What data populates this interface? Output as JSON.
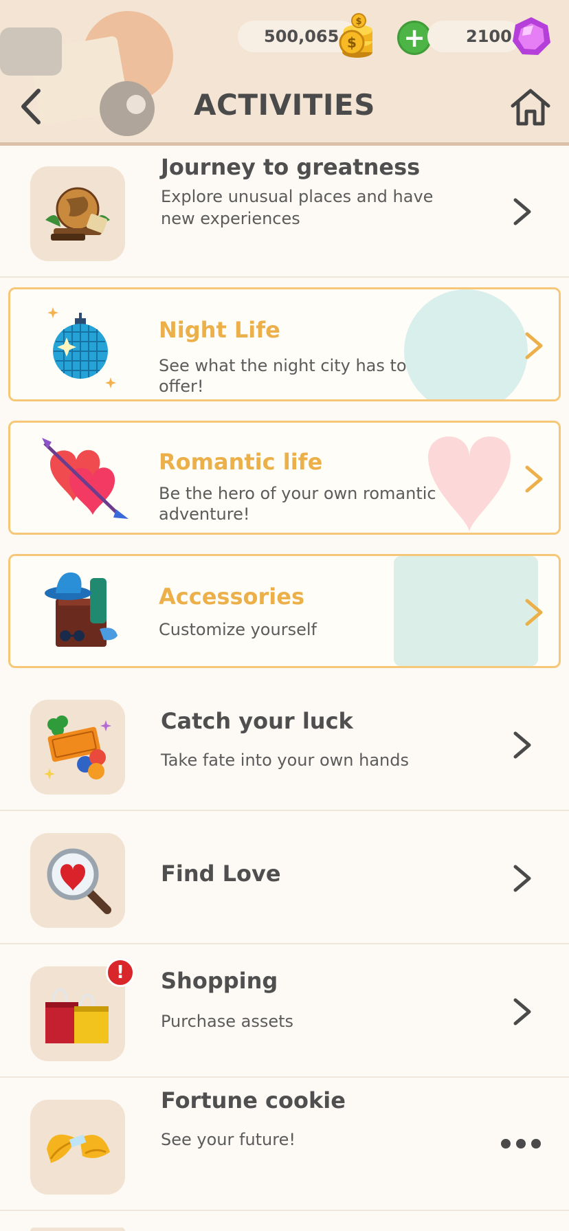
{
  "header": {
    "title": "ACTIVITIES",
    "coins": "500,065",
    "gems": "2100",
    "add_label": "+",
    "back_icon": "chevron-left-icon",
    "home_icon": "home-icon"
  },
  "colors": {
    "header_bg": "#f3e4d3",
    "accent_title": "#ebb04a",
    "special_border": "#f5c777",
    "plus_green": "#4cb545",
    "badge_red": "#d9262a"
  },
  "activities": [
    {
      "title": "Journey to greatness",
      "subtitle": "Explore unusual places and have new experiences",
      "icon": "globe-icon",
      "style": "normal",
      "action": "chevron"
    },
    {
      "title": "Night Life",
      "subtitle": "See what the night city has to offer!",
      "icon": "disco-ball-icon",
      "style": "special",
      "action": "chevron"
    },
    {
      "title": "Romantic life",
      "subtitle": "Be the hero of your own romantic adventure!",
      "icon": "hearts-arrow-icon",
      "style": "special",
      "action": "chevron"
    },
    {
      "title": "Accessories",
      "subtitle": "Customize yourself",
      "icon": "accessories-icon",
      "style": "special",
      "action": "chevron"
    },
    {
      "title": "Catch your luck",
      "subtitle": "Take fate into your own hands",
      "icon": "lottery-icon",
      "style": "normal",
      "action": "chevron"
    },
    {
      "title": "Find Love",
      "subtitle": "",
      "icon": "magnifier-heart-icon",
      "style": "normal",
      "action": "chevron"
    },
    {
      "title": "Shopping",
      "subtitle": "Purchase assets",
      "icon": "shopping-bags-icon",
      "style": "normal",
      "action": "chevron",
      "badge": "!"
    },
    {
      "title": "Fortune cookie",
      "subtitle": "See your future!",
      "icon": "fortune-cookie-icon",
      "style": "normal",
      "action": "more"
    }
  ]
}
